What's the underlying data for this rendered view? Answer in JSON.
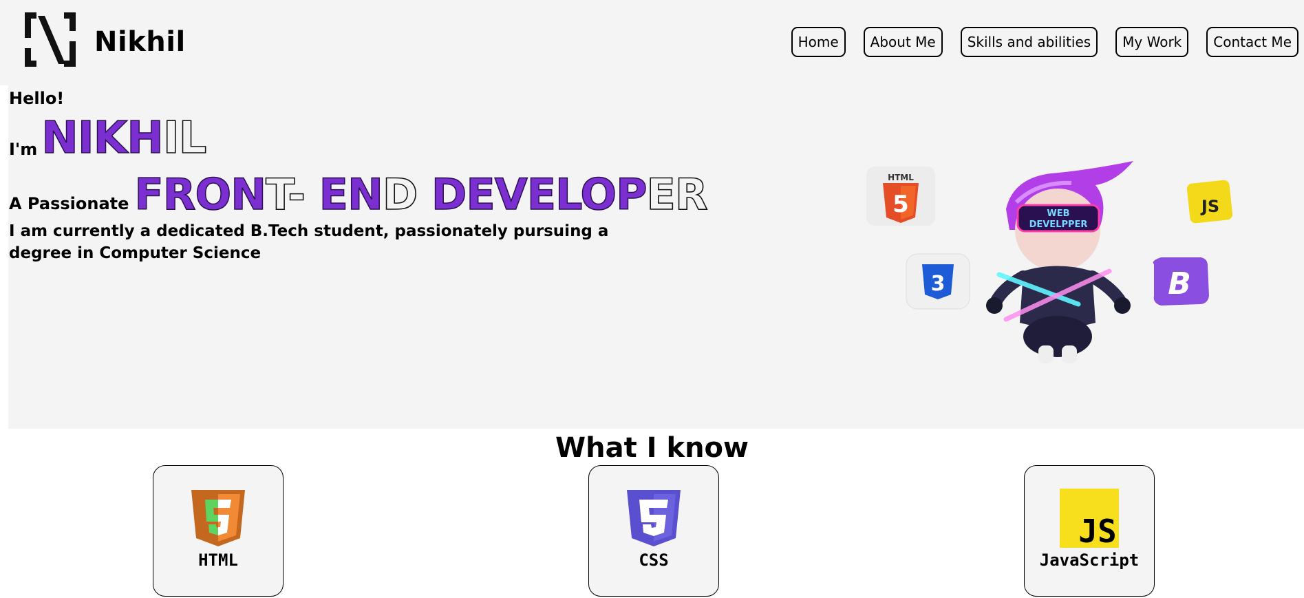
{
  "header": {
    "brand": "Nikhil",
    "logo_icon": "n-logo-icon",
    "nav": [
      {
        "label": "Home"
      },
      {
        "label": "About Me"
      },
      {
        "label": "Skills and abilities"
      },
      {
        "label": "My Work"
      },
      {
        "label": "Contact Me"
      }
    ]
  },
  "hero": {
    "greeting": "Hello!",
    "im_prefix": "I'm",
    "name_filled": "NIKH",
    "name_outline": "IL",
    "passionate_prefix": "A Passionate",
    "role_parts": [
      {
        "text": "FRON",
        "style": "fill"
      },
      {
        "text": "T- ",
        "style": "outline"
      },
      {
        "text": "EN",
        "style": "fill"
      },
      {
        "text": "D ",
        "style": "outline"
      },
      {
        "text": "DEVELOP",
        "style": "fill"
      },
      {
        "text": "ER",
        "style": "outline"
      }
    ],
    "description": "I am currently a dedicated B.Tech student, passionately pursuing a degree in Computer Science",
    "illustration": {
      "visor_text_1": "WEB",
      "visor_text_2": "DEVELPPER",
      "badges": [
        "html5-icon",
        "css3-icon",
        "js-icon",
        "bootstrap-icon"
      ],
      "html_badge_label": "HTML",
      "js_badge_label": "JS",
      "bootstrap_badge_label": "B"
    }
  },
  "skills": {
    "title": "What I know",
    "cards": [
      {
        "label": "HTML",
        "icon": "html5-icon"
      },
      {
        "label": "CSS",
        "icon": "css3-icon"
      },
      {
        "label": "JavaScript",
        "icon": "javascript-icon",
        "icon_text": "JS"
      }
    ]
  },
  "colors": {
    "accent": "#7b2fd0",
    "panel": "#f4f4f4",
    "html_orange": "#e44d26",
    "css_blue": "#5a4fcf",
    "js_yellow": "#f7df1e"
  }
}
